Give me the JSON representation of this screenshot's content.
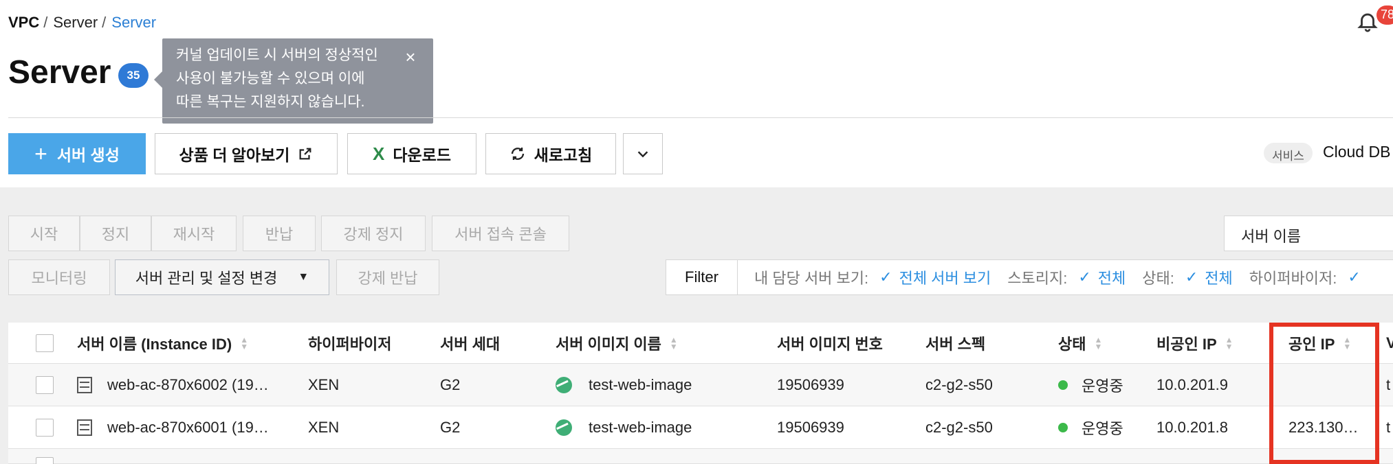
{
  "breadcrumb": {
    "root": "VPC",
    "parent": "Server",
    "current": "Server",
    "separator": "/"
  },
  "notifications": {
    "count": "78"
  },
  "page": {
    "title": "Server",
    "count": "35"
  },
  "tooltip": {
    "lines": [
      "커널 업데이트 시 서버의 정상적인",
      "사용이 불가능할 수 있으며 이에",
      "따른 복구는 지원하지 않습니다."
    ],
    "close_glyph": "×"
  },
  "toolbar": {
    "create_label": "서버 생성",
    "learn_more_label": "상품 더 알아보기",
    "download_label": "다운로드",
    "refresh_label": "새로고침",
    "more_glyph": "⌄"
  },
  "service": {
    "chip": "서비스",
    "name": "Cloud DB"
  },
  "actions": {
    "start": "시작",
    "stop": "정지",
    "restart": "재시작",
    "return": "반납",
    "force_stop": "강제 정지",
    "console": "서버 접속 콘솔",
    "monitoring": "모니터링",
    "manage": "서버 관리 및 설정 변경",
    "force_return": "강제 반납"
  },
  "search": {
    "select_label": "서버 이름"
  },
  "filter": {
    "label": "Filter",
    "items": [
      {
        "key": "내 담당 서버 보기:",
        "value": "전체 서버 보기"
      },
      {
        "key": "스토리지:",
        "value": "전체"
      },
      {
        "key": "상태:",
        "value": "전체"
      },
      {
        "key": "하이퍼바이저:",
        "value": ""
      }
    ]
  },
  "table": {
    "headers": {
      "name": "서버 이름 (Instance ID)",
      "hypervisor": "하이퍼바이저",
      "generation": "서버 세대",
      "image_name": "서버 이미지 이름",
      "image_no": "서버 이미지 번호",
      "spec": "서버 스펙",
      "status": "상태",
      "private_ip": "비공인 IP",
      "public_ip": "공인 IP",
      "next": "V"
    },
    "rows": [
      {
        "name": "web-ac-870x6002 (19…",
        "hypervisor": "XEN",
        "generation": "G2",
        "image_name": "test-web-image",
        "image_no": "19506939",
        "spec": "c2-g2-s50",
        "status": "운영중",
        "private_ip": "10.0.201.9",
        "public_ip": "",
        "next": "t"
      },
      {
        "name": "web-ac-870x6001 (19…",
        "hypervisor": "XEN",
        "generation": "G2",
        "image_name": "test-web-image",
        "image_no": "19506939",
        "spec": "c2-g2-s50",
        "status": "운영중",
        "private_ip": "10.0.201.8",
        "public_ip": "223.130…",
        "next": "t"
      }
    ]
  },
  "colors": {
    "accent": "#4aa6e8",
    "badge": "#2f7ad6",
    "status_running": "#3cb94a",
    "highlight": "#e53322",
    "link": "#2b8ee0"
  }
}
